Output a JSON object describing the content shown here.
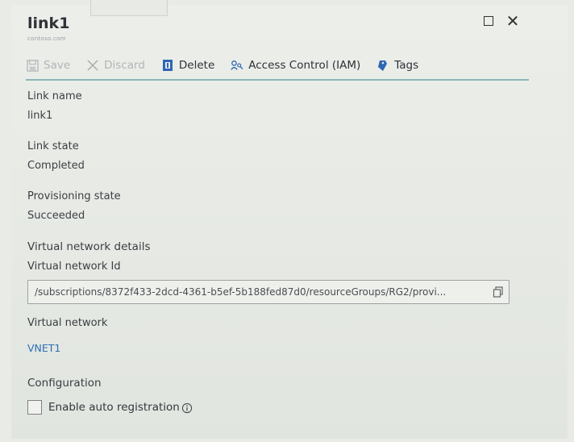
{
  "header": {
    "title": "link1",
    "subtitle": "contoso.com"
  },
  "toolbar": {
    "save_label": "Save",
    "discard_label": "Discard",
    "delete_label": "Delete",
    "iam_label": "Access Control (IAM)",
    "tags_label": "Tags"
  },
  "fields": {
    "link_name_label": "Link name",
    "link_name_value": "link1",
    "link_state_label": "Link state",
    "link_state_value": "Completed",
    "provisioning_state_label": "Provisioning state",
    "provisioning_state_value": "Succeeded",
    "vnet_details_label": "Virtual network details",
    "vnet_id_label": "Virtual network Id",
    "vnet_id_value": "/subscriptions/8372f433-2dcd-4361-b5ef-5b188fed87d0/resourceGroups/RG2/provi...",
    "vnet_label": "Virtual network",
    "vnet_value": "VNET1"
  },
  "configuration": {
    "label": "Configuration",
    "auto_registration_label": "Enable auto registration",
    "auto_registration_checked": false
  },
  "colors": {
    "accent_underline": "#8bb7b9",
    "link": "#2c6fb5",
    "icon_blue": "#2f66b3"
  }
}
